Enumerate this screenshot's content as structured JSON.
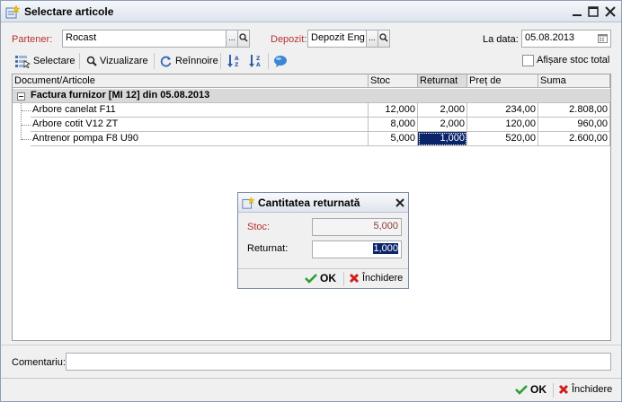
{
  "window": {
    "title": "Selectare articole"
  },
  "filters": {
    "partener_label": "Partener:",
    "partener_value": "Rocast",
    "depozit_label": "Depozit:",
    "depozit_value": "Depozit Eng",
    "date_label": "La data:",
    "date_value": "05.08.2013",
    "ellipsis": "...",
    "show_total_label": "Afișare stoc total"
  },
  "toolbar": {
    "select_label": "Selectare",
    "view_label": "Vizualizare",
    "refresh_label": "Reînnoire"
  },
  "grid": {
    "headers": [
      "Document/Articole",
      "Stoc",
      "Returnat",
      "Preț de achiziție",
      "Suma"
    ],
    "group_label": "Factura furnizor [MI 12] din 05.08.2013",
    "rows": [
      {
        "name": "Arbore canelat F11",
        "stoc": "12,000",
        "returnat": "2,000",
        "pret": "234,00",
        "suma": "2.808,00"
      },
      {
        "name": "Arbore cotit V12 ZT",
        "stoc": "8,000",
        "returnat": "2,000",
        "pret": "120,00",
        "suma": "960,00"
      },
      {
        "name": "Antrenor pompa F8 U90",
        "stoc": "5,000",
        "returnat": "1,000",
        "pret": "520,00",
        "suma": "2.600,00"
      }
    ]
  },
  "dialog": {
    "title": "Cantitatea returnată",
    "stoc_label": "Stoc:",
    "stoc_value": "5,000",
    "returnat_label": "Returnat:",
    "returnat_value": "1,000",
    "ok_label": "OK",
    "close_label": "Închidere"
  },
  "comment": {
    "label": "Comentariu:",
    "value": ""
  },
  "footer": {
    "ok_label": "OK",
    "close_label": "Închidere"
  },
  "colors": {
    "accent_red": "#b8312f",
    "selection": "#0a246a",
    "ok_green": "#2f9e2f",
    "close_red": "#d11f1f"
  }
}
